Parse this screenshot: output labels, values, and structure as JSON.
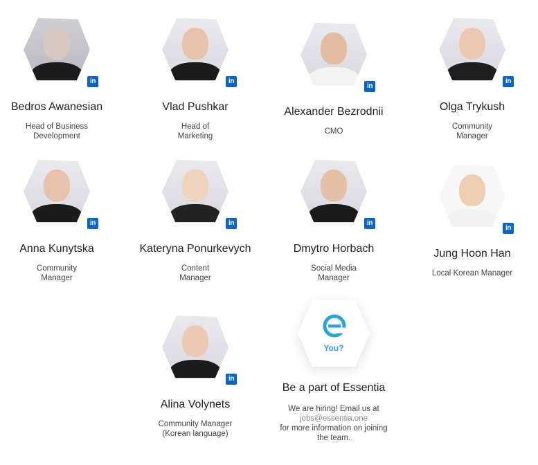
{
  "members": [
    {
      "name": "Bedros Awanesian",
      "role": "Head of Business\nDevelopment",
      "linkedin": "in"
    },
    {
      "name": "Vlad Pushkar",
      "role": "Head of\nMarketing",
      "linkedin": "in"
    },
    {
      "name": "Alexander Bezrodnii",
      "role": "CMO",
      "linkedin": "in"
    },
    {
      "name": "Olga Trykush",
      "role": "Community\nManager",
      "linkedin": "in"
    },
    {
      "name": "Anna Kunytska",
      "role": "Community\nManager",
      "linkedin": "in"
    },
    {
      "name": "Kateryna Ponurkevych",
      "role": "Content\nManager",
      "linkedin": "in"
    },
    {
      "name": "Dmytro Horbach",
      "role": "Social Media\nManager",
      "linkedin": "in"
    },
    {
      "name": "Jung Hoon Han",
      "role": "Local Korean Manager",
      "linkedin": "in"
    },
    {
      "name": "Alina Volynets",
      "role": "Community Manager\n(Korean language)",
      "linkedin": "in"
    }
  ],
  "hiring": {
    "badge": "You?",
    "title": "Be a part of Essentia",
    "line1": "We are hiring! Email us at",
    "email": "jobs@essentia.one",
    "line2": "for more information on joining",
    "line3": "the team."
  },
  "colors": {
    "linkedin": "#0a66c2",
    "brand": "#2aa3e0"
  }
}
